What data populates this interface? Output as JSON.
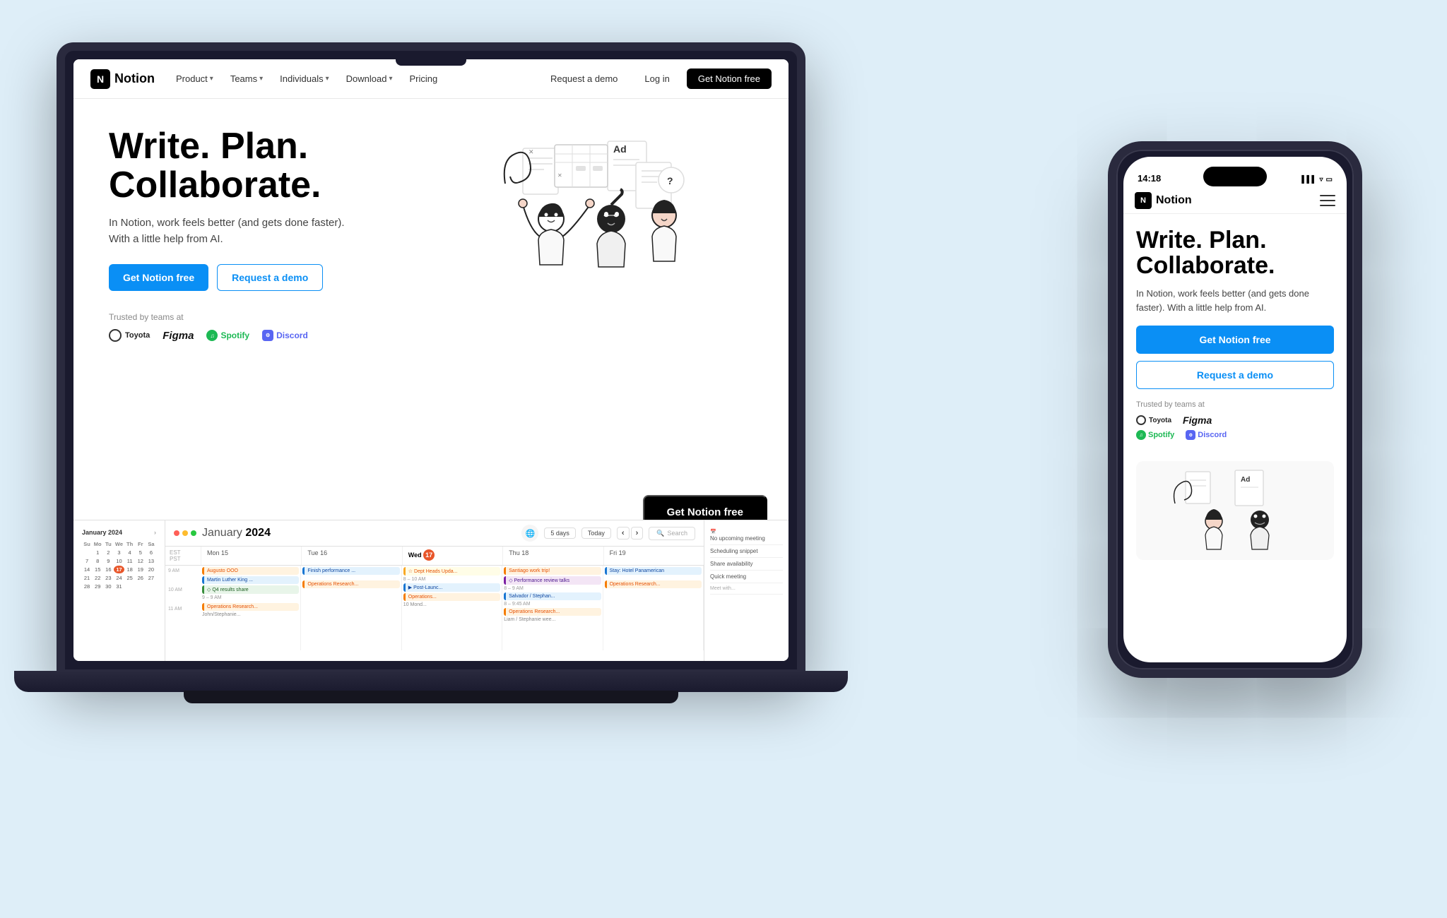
{
  "page": {
    "bg_color": "#deeef8",
    "title": "Notion - Write. Plan. Collaborate."
  },
  "nav": {
    "logo": "Notion",
    "logo_icon": "N",
    "links": [
      {
        "label": "Product",
        "has_dropdown": true
      },
      {
        "label": "Teams",
        "has_dropdown": true
      },
      {
        "label": "Individuals",
        "has_dropdown": true
      },
      {
        "label": "Download",
        "has_dropdown": true
      },
      {
        "label": "Pricing",
        "has_dropdown": false
      }
    ],
    "request_demo": "Request a demo",
    "login": "Log in",
    "cta": "Get Notion free"
  },
  "hero": {
    "headline": "Write. Plan.\nCollaborate.",
    "headline_line1": "Write. Plan.",
    "headline_line2": "Collaborate.",
    "subtext": "In Notion, work feels better (and gets done faster). With a little help from AI.",
    "cta_primary": "Get Notion free",
    "cta_secondary": "Request a demo",
    "trusted_label": "Trusted by teams at",
    "logos": [
      "Toyota",
      "Figma",
      "Spotify",
      "Discord"
    ]
  },
  "phone": {
    "time": "14:18",
    "nav_logo": "Notion",
    "headline_line1": "Write. Plan.",
    "headline_line2": "Collaborate.",
    "subtext": "In Notion, work feels better (and gets done faster). With a little help from AI.",
    "cta_primary": "Get Notion free",
    "cta_secondary": "Request a demo",
    "trusted_label": "Trusted by teams at",
    "logos": [
      "Toyota",
      "Figma",
      "Spotify",
      "Discord"
    ]
  },
  "calendar": {
    "title": "January 2024",
    "toolbar": {
      "view": "5 days",
      "today": "Today",
      "search_placeholder": "Search"
    },
    "days": [
      "Mon 15",
      "Tue 16",
      "Wed 17",
      "Thu 18",
      "Fri 19"
    ],
    "mini_month": "January 2024",
    "sidebar_right": [
      {
        "label": "No upcoming meeting",
        "time": ""
      },
      {
        "label": "Scheduling snippet",
        "time": ""
      },
      {
        "label": "Share availability",
        "time": ""
      },
      {
        "label": "Quick meeting",
        "time": ""
      }
    ],
    "events": [
      {
        "day": 0,
        "title": "Augusto OOO",
        "color": "orange"
      },
      {
        "day": 0,
        "title": "Martin Luther King ...",
        "color": "blue"
      },
      {
        "day": 0,
        "title": "Q4 results share",
        "color": "green"
      },
      {
        "day": 1,
        "title": "Finish performance ...",
        "color": "blue"
      },
      {
        "day": 2,
        "title": "Dept Heads Upda...",
        "color": "yellow"
      },
      {
        "day": 3,
        "title": "Santiago work trip!",
        "color": "orange"
      },
      {
        "day": 3,
        "title": "Performance review talks",
        "color": "purple"
      },
      {
        "day": 4,
        "title": "Stay: Hotel Panamerican",
        "color": "blue"
      }
    ]
  }
}
